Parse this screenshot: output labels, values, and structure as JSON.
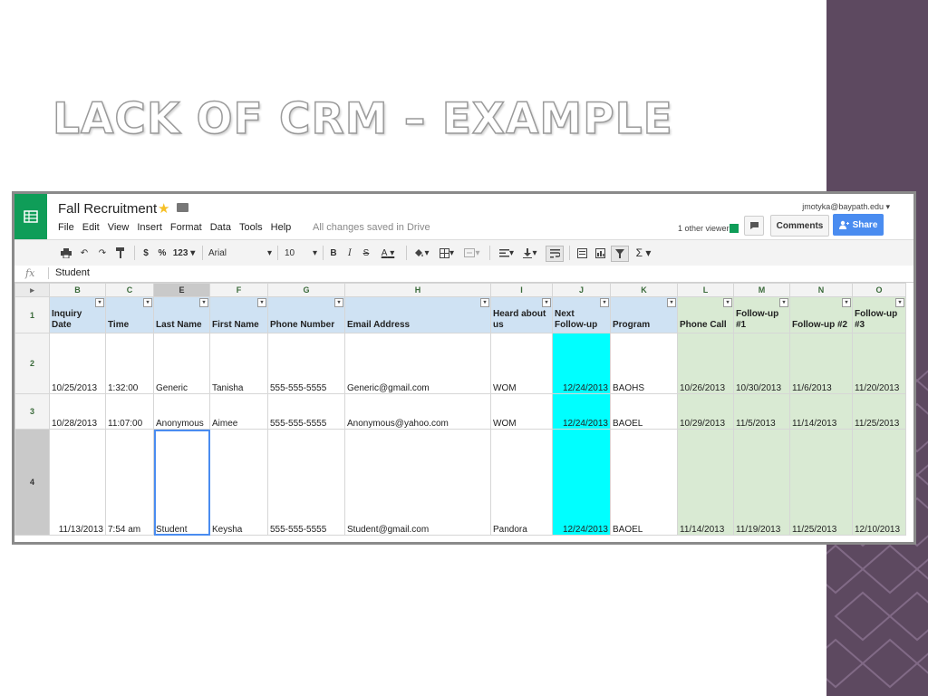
{
  "slide": {
    "title": "LACK OF CRM – EXAMPLE"
  },
  "app": {
    "doc_title": "Fall Recruitment",
    "menu": [
      "File",
      "Edit",
      "View",
      "Insert",
      "Format",
      "Data",
      "Tools",
      "Help"
    ],
    "save_status": "All changes saved in Drive",
    "user_email": "jmotyka@baypath.edu",
    "viewers": "1 other viewer",
    "comments_label": "Comments",
    "share_label": "Share"
  },
  "toolbar": {
    "currency": "$",
    "percent": "%",
    "number_format": "123",
    "font": "Arial",
    "font_size": "10",
    "bold": "B",
    "italic": "I",
    "strike": "S",
    "text_color": "A",
    "sigma": "Σ"
  },
  "formula_bar": {
    "fx": "fx",
    "value": "Student"
  },
  "columns": [
    "B",
    "C",
    "E",
    "F",
    "G",
    "H",
    "I",
    "J",
    "K",
    "L",
    "M",
    "N",
    "O"
  ],
  "row_numbers": [
    "1",
    "2",
    "3",
    "4"
  ],
  "headers": [
    "Inquiry Date",
    "Time",
    "Last Name",
    "First Name",
    "Phone Number",
    "Email Address",
    "Heard about us",
    "Next Follow-up",
    "Program",
    "Phone Call",
    "Follow-up #1",
    "Follow-up #2",
    "Follow-up #3"
  ],
  "rows": [
    [
      "10/25/2013",
      "1:32:00",
      "Generic",
      "Tanisha",
      "555-555-5555",
      "Generic@gmail.com",
      "WOM",
      "12/24/2013",
      "BAOHS",
      "10/26/2013",
      "10/30/2013",
      "11/6/2013",
      "11/20/2013"
    ],
    [
      "10/28/2013",
      "11:07:00",
      "Anonymous",
      "Aimee",
      "555-555-5555",
      "Anonymous@yahoo.com",
      "WOM",
      "12/24/2013",
      "BAOEL",
      "10/29/2013",
      "11/5/2013",
      "11/14/2013",
      "11/25/2013"
    ],
    [
      "11/13/2013",
      "7:54 am",
      "Student",
      "Keysha",
      "555-555-5555",
      "Student@gmail.com",
      "Pandora",
      "12/24/2013",
      "BAOEL",
      "11/14/2013",
      "11/19/2013",
      "11/25/2013",
      "12/10/2013"
    ]
  ],
  "colors": {
    "accent_cyan": "#00ffff",
    "header_blue": "#cfe2f3",
    "header_green": "#d9ead3",
    "sheets_green": "#0f9d58",
    "share_blue": "#4a8cf0"
  }
}
